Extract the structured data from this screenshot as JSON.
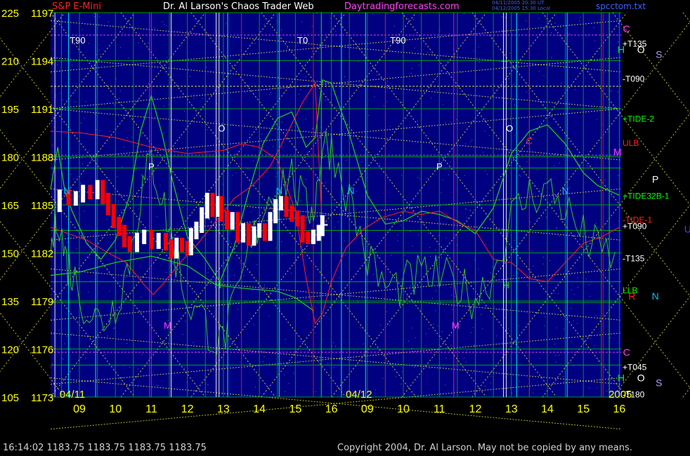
{
  "header": {
    "instrument": "S&P E-Mini",
    "title": "Dr. Al Larson's Chaos Trader Web",
    "site": "Daytradingforecasts.com",
    "stamp_line1": "04/11/2005 20:30 UT",
    "stamp_line2": "04/12/2005 15:30 Local",
    "filename": "spcctom.txt"
  },
  "footer": {
    "quote": "16:14:02  1183.75 1183.75 1183.75 1183.75",
    "copyright": "Copyright 2004, Dr. Al Larson. May not be copied by any means."
  },
  "colors": {
    "background": "#000080",
    "grid_green": "#00c000",
    "grid_yellow": "#ffff40",
    "price_white": "#ffffff",
    "price_red": "#ff0000",
    "flux_green": "#20d020",
    "tide_red": "#ff2020",
    "time_cyan": "#00ffff",
    "time_magenta": "#ff00ff",
    "axis_yellow": "#ffff00"
  },
  "chart_data": {
    "type": "line",
    "title": "S&P E-Mini",
    "y_left_outer_ticks": [
      "225",
      "210",
      "195",
      "180",
      "165",
      "150",
      "135",
      "120",
      "105"
    ],
    "y_left_inner_ticks": [
      "1197",
      "1194",
      "1191",
      "1188",
      "1185",
      "1182",
      "1179",
      "1176",
      "1173"
    ],
    "y_range_outer": [
      105,
      225
    ],
    "y_range_price": [
      1173,
      1197
    ],
    "x_hour_ticks": [
      {
        "label": "09",
        "i": 0
      },
      {
        "label": "10",
        "i": 1
      },
      {
        "label": "11",
        "i": 2
      },
      {
        "label": "12",
        "i": 3
      },
      {
        "label": "13",
        "i": 4
      },
      {
        "label": "14",
        "i": 5
      },
      {
        "label": "15",
        "i": 6
      },
      {
        "label": "16",
        "i": 7
      },
      {
        "label": "09",
        "i": 8
      },
      {
        "label": "10",
        "i": 9
      },
      {
        "label": "11",
        "i": 10
      },
      {
        "label": "12",
        "i": 11
      },
      {
        "label": "13",
        "i": 12
      },
      {
        "label": "14",
        "i": 13
      },
      {
        "label": "15",
        "i": 14
      },
      {
        "label": "16",
        "i": 15
      }
    ],
    "x_range": [
      -0.8,
      15.05
    ],
    "date_labels": [
      {
        "label": "04/11",
        "at": -0.55
      },
      {
        "label": "04/12",
        "at": 7.4
      },
      {
        "label": "2005",
        "at": 14.7
      }
    ],
    "right_labels": [
      {
        "text": "+T135",
        "y": 1195.1,
        "color": "#ffffff"
      },
      {
        "text": "-T090",
        "y": 1192.9,
        "color": "#ffffff"
      },
      {
        "text": "+TIDE-2",
        "y": 1190.4,
        "color": "#00ff00"
      },
      {
        "text": "ULB",
        "y": 1188.9,
        "color": "#ff2020"
      },
      {
        "text": "+TIDE32B-1",
        "y": 1185.6,
        "color": "#00ff00"
      },
      {
        "text": "-TIDE-1",
        "y": 1184.1,
        "color": "#ff2020"
      },
      {
        "text": "+T090",
        "y": 1183.7,
        "color": "#ffffff"
      },
      {
        "text": "-T135",
        "y": 1181.7,
        "color": "#ffffff"
      },
      {
        "text": "LLB",
        "y": 1179.7,
        "color": "#00ff00"
      },
      {
        "text": "+T045",
        "y": 1174.9,
        "color": "#ffffff"
      },
      {
        "text": "-T180",
        "y": 1173.2,
        "color": "#ffffff"
      }
    ],
    "planet_labels": [
      {
        "text": "C",
        "x": 15.2,
        "y": 1196.0,
        "color": "#ff40ff"
      },
      {
        "text": "H",
        "x": 15.05,
        "y": 1194.7,
        "color": "#00ff00"
      },
      {
        "text": "O",
        "x": 15.6,
        "y": 1194.7,
        "color": "#ffffff"
      },
      {
        "text": "S",
        "x": 16.1,
        "y": 1194.4,
        "color": "#a0a0ff"
      },
      {
        "text": "M",
        "x": 14.95,
        "y": 1188.3,
        "color": "#ff40ff"
      },
      {
        "text": "P",
        "x": 16.0,
        "y": 1186.6,
        "color": "#ffffff"
      },
      {
        "text": "U",
        "x": 16.9,
        "y": 1183.5,
        "color": "#4040ff"
      },
      {
        "text": "R",
        "x": 15.35,
        "y": 1179.3,
        "color": "#ff2020"
      },
      {
        "text": "N",
        "x": 16.0,
        "y": 1179.3,
        "color": "#00c0ff"
      },
      {
        "text": "C",
        "x": 15.2,
        "y": 1175.8,
        "color": "#ff40ff"
      },
      {
        "text": "H",
        "x": 15.05,
        "y": 1174.2,
        "color": "#00ff00"
      },
      {
        "text": "O",
        "x": 15.6,
        "y": 1174.2,
        "color": "#ffffff"
      },
      {
        "text": "S",
        "x": 16.1,
        "y": 1173.9,
        "color": "#a0a0ff"
      }
    ],
    "chart_markers": [
      {
        "text": "T90",
        "x": -0.05,
        "y": 1195.3,
        "color": "#ffffff"
      },
      {
        "text": "T0",
        "x": 6.2,
        "y": 1195.3,
        "color": "#ffffff"
      },
      {
        "text": "T90",
        "x": 8.85,
        "y": 1195.3,
        "color": "#ffffff"
      },
      {
        "text": "O",
        "x": 3.95,
        "y": 1189.8,
        "color": "#ffffff"
      },
      {
        "text": "O",
        "x": 11.95,
        "y": 1189.8,
        "color": "#ffffff"
      },
      {
        "text": "P",
        "x": 2.0,
        "y": 1187.4,
        "color": "#ffffff"
      },
      {
        "text": "P",
        "x": 10.0,
        "y": 1187.4,
        "color": "#ffffff"
      },
      {
        "text": "N",
        "x": -0.35,
        "y": 1185.9,
        "color": "#00c0ff"
      },
      {
        "text": "N",
        "x": 5.55,
        "y": 1185.9,
        "color": "#00c0ff"
      },
      {
        "text": "N",
        "x": 7.55,
        "y": 1185.9,
        "color": "#00c0ff"
      },
      {
        "text": "N",
        "x": 13.5,
        "y": 1185.9,
        "color": "#00c0ff"
      },
      {
        "text": "C",
        "x": 12.5,
        "y": 1189.0,
        "color": "#ff2020"
      },
      {
        "text": "H",
        "x": 3.85,
        "y": 1180.0,
        "color": "#00ff00"
      },
      {
        "text": "H",
        "x": 11.85,
        "y": 1180.0,
        "color": "#00ff00"
      },
      {
        "text": "M",
        "x": 2.45,
        "y": 1177.5,
        "color": "#ff40ff"
      },
      {
        "text": "M",
        "x": 10.45,
        "y": 1177.5,
        "color": "#ff40ff"
      }
    ],
    "vertical_time_lines": [
      {
        "x": -0.68,
        "color": "#ffffff"
      },
      {
        "x": -0.3,
        "color": "#00ffff"
      },
      {
        "x": 0.45,
        "color": "#00ffff"
      },
      {
        "x": 1.95,
        "color": "#ff00ff"
      },
      {
        "x": 2.55,
        "color": "#ffffff"
      },
      {
        "x": 3.8,
        "color": "#ffffff"
      },
      {
        "x": 3.88,
        "color": "#ffffff"
      },
      {
        "x": 4.12,
        "color": "#00ffff"
      },
      {
        "x": 4.5,
        "color": "#ff0000"
      },
      {
        "x": 5.55,
        "color": "#00ffff"
      },
      {
        "x": 6.5,
        "color": "#ff0000"
      },
      {
        "x": 6.72,
        "color": "#00ff00"
      },
      {
        "x": 7.28,
        "color": "#00ffff"
      },
      {
        "x": 7.95,
        "color": "#00ffff"
      },
      {
        "x": 8.5,
        "color": "#ff0000"
      },
      {
        "x": 10.4,
        "color": "#ff00ff"
      },
      {
        "x": 11.78,
        "color": "#ffffff"
      },
      {
        "x": 11.86,
        "color": "#ffffff"
      },
      {
        "x": 12.15,
        "color": "#00ffff"
      },
      {
        "x": 12.5,
        "color": "#ff0000"
      },
      {
        "x": 13.55,
        "color": "#00ffff"
      },
      {
        "x": 14.55,
        "color": "#ff0000"
      },
      {
        "x": 14.72,
        "color": "#00ff00"
      }
    ],
    "horizontal_levels": [
      {
        "y": 1195.6,
        "color": "#ff40ff"
      },
      {
        "y": 1192.4,
        "color": "#ffff40"
      },
      {
        "y": 1188.1,
        "color": "#ff40ff"
      },
      {
        "y": 1187.3,
        "color": "#00c000"
      },
      {
        "y": 1183.4,
        "color": "#00c000"
      },
      {
        "y": 1180.2,
        "color": "#00c000"
      },
      {
        "y": 1178.9,
        "color": "#00c000"
      },
      {
        "y": 1175.8,
        "color": "#ff40ff"
      },
      {
        "y": 1175.0,
        "color": "#00c000"
      }
    ],
    "price_series": [
      {
        "x": -0.8,
        "y": 1184.9
      },
      {
        "x": -0.55,
        "y": 1185.6
      },
      {
        "x": -0.3,
        "y": 1185.3
      },
      {
        "x": -0.1,
        "y": 1185.5
      },
      {
        "x": 0.1,
        "y": 1185.9
      },
      {
        "x": 0.3,
        "y": 1185.7
      },
      {
        "x": 0.5,
        "y": 1186.2
      },
      {
        "x": 0.65,
        "y": 1185.4
      },
      {
        "x": 0.8,
        "y": 1184.7
      },
      {
        "x": 0.95,
        "y": 1183.9
      },
      {
        "x": 1.1,
        "y": 1183.4
      },
      {
        "x": 1.25,
        "y": 1182.7
      },
      {
        "x": 1.4,
        "y": 1182.4
      },
      {
        "x": 1.6,
        "y": 1182.9
      },
      {
        "x": 1.8,
        "y": 1183.1
      },
      {
        "x": 2.0,
        "y": 1182.6
      },
      {
        "x": 2.2,
        "y": 1182.9
      },
      {
        "x": 2.4,
        "y": 1182.5
      },
      {
        "x": 2.55,
        "y": 1182.0
      },
      {
        "x": 2.7,
        "y": 1182.6
      },
      {
        "x": 2.85,
        "y": 1182.4
      },
      {
        "x": 3.0,
        "y": 1182.2
      },
      {
        "x": 3.1,
        "y": 1183.2
      },
      {
        "x": 3.25,
        "y": 1183.6
      },
      {
        "x": 3.4,
        "y": 1184.5
      },
      {
        "x": 3.55,
        "y": 1185.4
      },
      {
        "x": 3.7,
        "y": 1184.6
      },
      {
        "x": 3.85,
        "y": 1185.2
      },
      {
        "x": 3.95,
        "y": 1184.3
      },
      {
        "x": 4.1,
        "y": 1183.8
      },
      {
        "x": 4.25,
        "y": 1184.2
      },
      {
        "x": 4.4,
        "y": 1183.0
      },
      {
        "x": 4.55,
        "y": 1183.5
      },
      {
        "x": 4.7,
        "y": 1182.8
      },
      {
        "x": 4.85,
        "y": 1183.3
      },
      {
        "x": 5.0,
        "y": 1183.5
      },
      {
        "x": 5.15,
        "y": 1183.1
      },
      {
        "x": 5.3,
        "y": 1184.2
      },
      {
        "x": 5.45,
        "y": 1185.0
      },
      {
        "x": 5.6,
        "y": 1185.2
      },
      {
        "x": 5.75,
        "y": 1184.6
      },
      {
        "x": 5.9,
        "y": 1184.3
      },
      {
        "x": 6.05,
        "y": 1184.0
      },
      {
        "x": 6.2,
        "y": 1183.0
      },
      {
        "x": 6.35,
        "y": 1182.9
      },
      {
        "x": 6.5,
        "y": 1183.1
      },
      {
        "x": 6.65,
        "y": 1183.4
      },
      {
        "x": 6.75,
        "y": 1184.0
      }
    ],
    "tide_red": [
      {
        "x": -0.8,
        "y": 1189.6
      },
      {
        "x": 0.0,
        "y": 1189.5
      },
      {
        "x": 1.0,
        "y": 1189.2
      },
      {
        "x": 2.0,
        "y": 1188.6
      },
      {
        "x": 3.0,
        "y": 1188.2
      },
      {
        "x": 4.0,
        "y": 1188.4
      },
      {
        "x": 4.5,
        "y": 1188.8
      },
      {
        "x": 5.0,
        "y": 1188.6
      },
      {
        "x": 5.5,
        "y": 1187.8
      },
      {
        "x": 6.0,
        "y": 1184.6
      },
      {
        "x": 6.3,
        "y": 1180.4
      },
      {
        "x": 6.55,
        "y": 1177.6
      },
      {
        "x": 6.75,
        "y": 1178.2
      },
      {
        "x": 7.0,
        "y": 1180.2
      },
      {
        "x": 7.4,
        "y": 1182.3
      },
      {
        "x": 7.9,
        "y": 1183.5
      },
      {
        "x": 8.4,
        "y": 1184.2
      },
      {
        "x": 9.0,
        "y": 1184.6
      },
      {
        "x": 9.5,
        "y": 1184.4
      },
      {
        "x": 10.0,
        "y": 1184.6
      },
      {
        "x": 10.6,
        "y": 1183.8
      },
      {
        "x": 11.0,
        "y": 1183.4
      },
      {
        "x": 11.5,
        "y": 1181.6
      },
      {
        "x": 12.0,
        "y": 1181.4
      },
      {
        "x": 12.5,
        "y": 1180.4
      },
      {
        "x": 13.0,
        "y": 1180.2
      },
      {
        "x": 13.5,
        "y": 1181.4
      },
      {
        "x": 14.0,
        "y": 1182.6
      },
      {
        "x": 14.5,
        "y": 1183.0
      },
      {
        "x": 15.0,
        "y": 1183.6
      }
    ],
    "tide_red2": [
      {
        "x": -0.8,
        "y": 1183.6
      },
      {
        "x": 0.2,
        "y": 1182.8
      },
      {
        "x": 0.8,
        "y": 1182.0
      },
      {
        "x": 1.3,
        "y": 1181.4
      },
      {
        "x": 1.8,
        "y": 1180.0
      },
      {
        "x": 2.05,
        "y": 1179.4
      },
      {
        "x": 2.3,
        "y": 1180.0
      },
      {
        "x": 2.8,
        "y": 1181.4
      },
      {
        "x": 3.3,
        "y": 1182.6
      },
      {
        "x": 3.8,
        "y": 1184.0
      },
      {
        "x": 4.3,
        "y": 1185.4
      },
      {
        "x": 4.8,
        "y": 1186.2
      },
      {
        "x": 5.3,
        "y": 1187.4
      },
      {
        "x": 5.8,
        "y": 1189.6
      },
      {
        "x": 6.2,
        "y": 1191.4
      },
      {
        "x": 6.55,
        "y": 1192.6
      },
      {
        "x": 6.75,
        "y": 1183.4
      }
    ],
    "flux_green": [
      {
        "x": -0.8,
        "y": 1186.0
      },
      {
        "x": -0.6,
        "y": 1188.6
      },
      {
        "x": -0.4,
        "y": 1185.8
      },
      {
        "x": -0.2,
        "y": 1184.6
      },
      {
        "x": 0.2,
        "y": 1182.6
      },
      {
        "x": 0.6,
        "y": 1181.6
      },
      {
        "x": 1.0,
        "y": 1182.8
      },
      {
        "x": 1.4,
        "y": 1185.6
      },
      {
        "x": 1.7,
        "y": 1189.6
      },
      {
        "x": 2.0,
        "y": 1191.8
      },
      {
        "x": 2.3,
        "y": 1189.4
      },
      {
        "x": 2.6,
        "y": 1186.4
      },
      {
        "x": 3.0,
        "y": 1183.0
      },
      {
        "x": 3.5,
        "y": 1181.6
      },
      {
        "x": 3.9,
        "y": 1180.2
      },
      {
        "x": 4.3,
        "y": 1182.4
      },
      {
        "x": 4.7,
        "y": 1185.8
      },
      {
        "x": 5.1,
        "y": 1188.8
      },
      {
        "x": 5.5,
        "y": 1190.4
      },
      {
        "x": 5.9,
        "y": 1190.8
      },
      {
        "x": 6.3,
        "y": 1188.6
      },
      {
        "x": 6.55,
        "y": 1189.2
      },
      {
        "x": 6.75,
        "y": 1192.8
      },
      {
        "x": 7.0,
        "y": 1192.6
      },
      {
        "x": 7.5,
        "y": 1189.4
      },
      {
        "x": 8.0,
        "y": 1185.6
      },
      {
        "x": 8.5,
        "y": 1183.8
      },
      {
        "x": 9.0,
        "y": 1184.0
      },
      {
        "x": 9.5,
        "y": 1184.6
      },
      {
        "x": 10.0,
        "y": 1184.4
      },
      {
        "x": 10.5,
        "y": 1184.0
      },
      {
        "x": 11.0,
        "y": 1183.2
      },
      {
        "x": 11.5,
        "y": 1184.8
      },
      {
        "x": 12.0,
        "y": 1188.2
      },
      {
        "x": 12.5,
        "y": 1189.6
      },
      {
        "x": 13.0,
        "y": 1190.0
      },
      {
        "x": 13.5,
        "y": 1188.8
      },
      {
        "x": 14.0,
        "y": 1187.0
      },
      {
        "x": 14.4,
        "y": 1186.2
      },
      {
        "x": 15.0,
        "y": 1185.6
      }
    ],
    "flux_green2": [
      {
        "x": -0.8,
        "y": 1180.6
      },
      {
        "x": 0.0,
        "y": 1180.8
      },
      {
        "x": 1.0,
        "y": 1181.4
      },
      {
        "x": 2.0,
        "y": 1181.8
      },
      {
        "x": 3.0,
        "y": 1181.2
      },
      {
        "x": 3.8,
        "y": 1180.0
      },
      {
        "x": 4.5,
        "y": 1179.8
      },
      {
        "x": 5.5,
        "y": 1179.6
      },
      {
        "x": 6.0,
        "y": 1179.2
      },
      {
        "x": 6.5,
        "y": 1178.4
      }
    ]
  }
}
